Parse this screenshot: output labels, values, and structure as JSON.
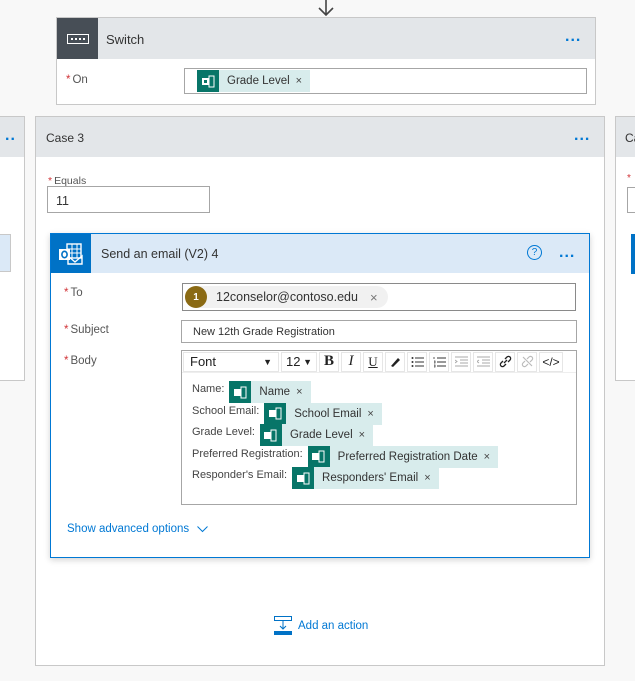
{
  "switch": {
    "title": "Switch",
    "more_label": "...",
    "on_label": "On",
    "required_mark": "*",
    "on_token": {
      "label": "Grade Level",
      "remove": "×"
    }
  },
  "cases": {
    "left_more": "..",
    "right_title": "Ca",
    "case3": {
      "title": "Case 3",
      "more_label": "...",
      "equals_label": "Equals",
      "equals_value": "11"
    }
  },
  "email": {
    "title": "Send an email (V2) 4",
    "help": "?",
    "more_label": "...",
    "to_label": "To",
    "to_recipient": {
      "initial": "1",
      "address": "12conselor@contoso.edu",
      "remove": "×"
    },
    "subject_label": "Subject",
    "subject_value": "New 12th Grade Registration",
    "body_label": "Body",
    "toolbar": {
      "font": "Font",
      "size": "12",
      "caret": "▼",
      "bold": "B",
      "italic": "I",
      "underline": "U",
      "code": "</>"
    },
    "body_lines": [
      {
        "label": "Name:",
        "token": "Name"
      },
      {
        "label": "School Email:",
        "token": "School Email"
      },
      {
        "label": "Grade Level:",
        "token": "Grade Level"
      },
      {
        "label": "Preferred Registration:",
        "token": "Preferred Registration Date"
      },
      {
        "label": "Responder's Email:",
        "token": "Responders' Email"
      }
    ],
    "token_remove": "×",
    "advanced": "Show advanced options"
  },
  "add_action": "Add an action",
  "colors": {
    "accent": "#0078d4",
    "token_bg": "#d8ecec",
    "token_icon": "#077568",
    "outlook": "#0072c6",
    "switch_icon": "#474e56"
  }
}
